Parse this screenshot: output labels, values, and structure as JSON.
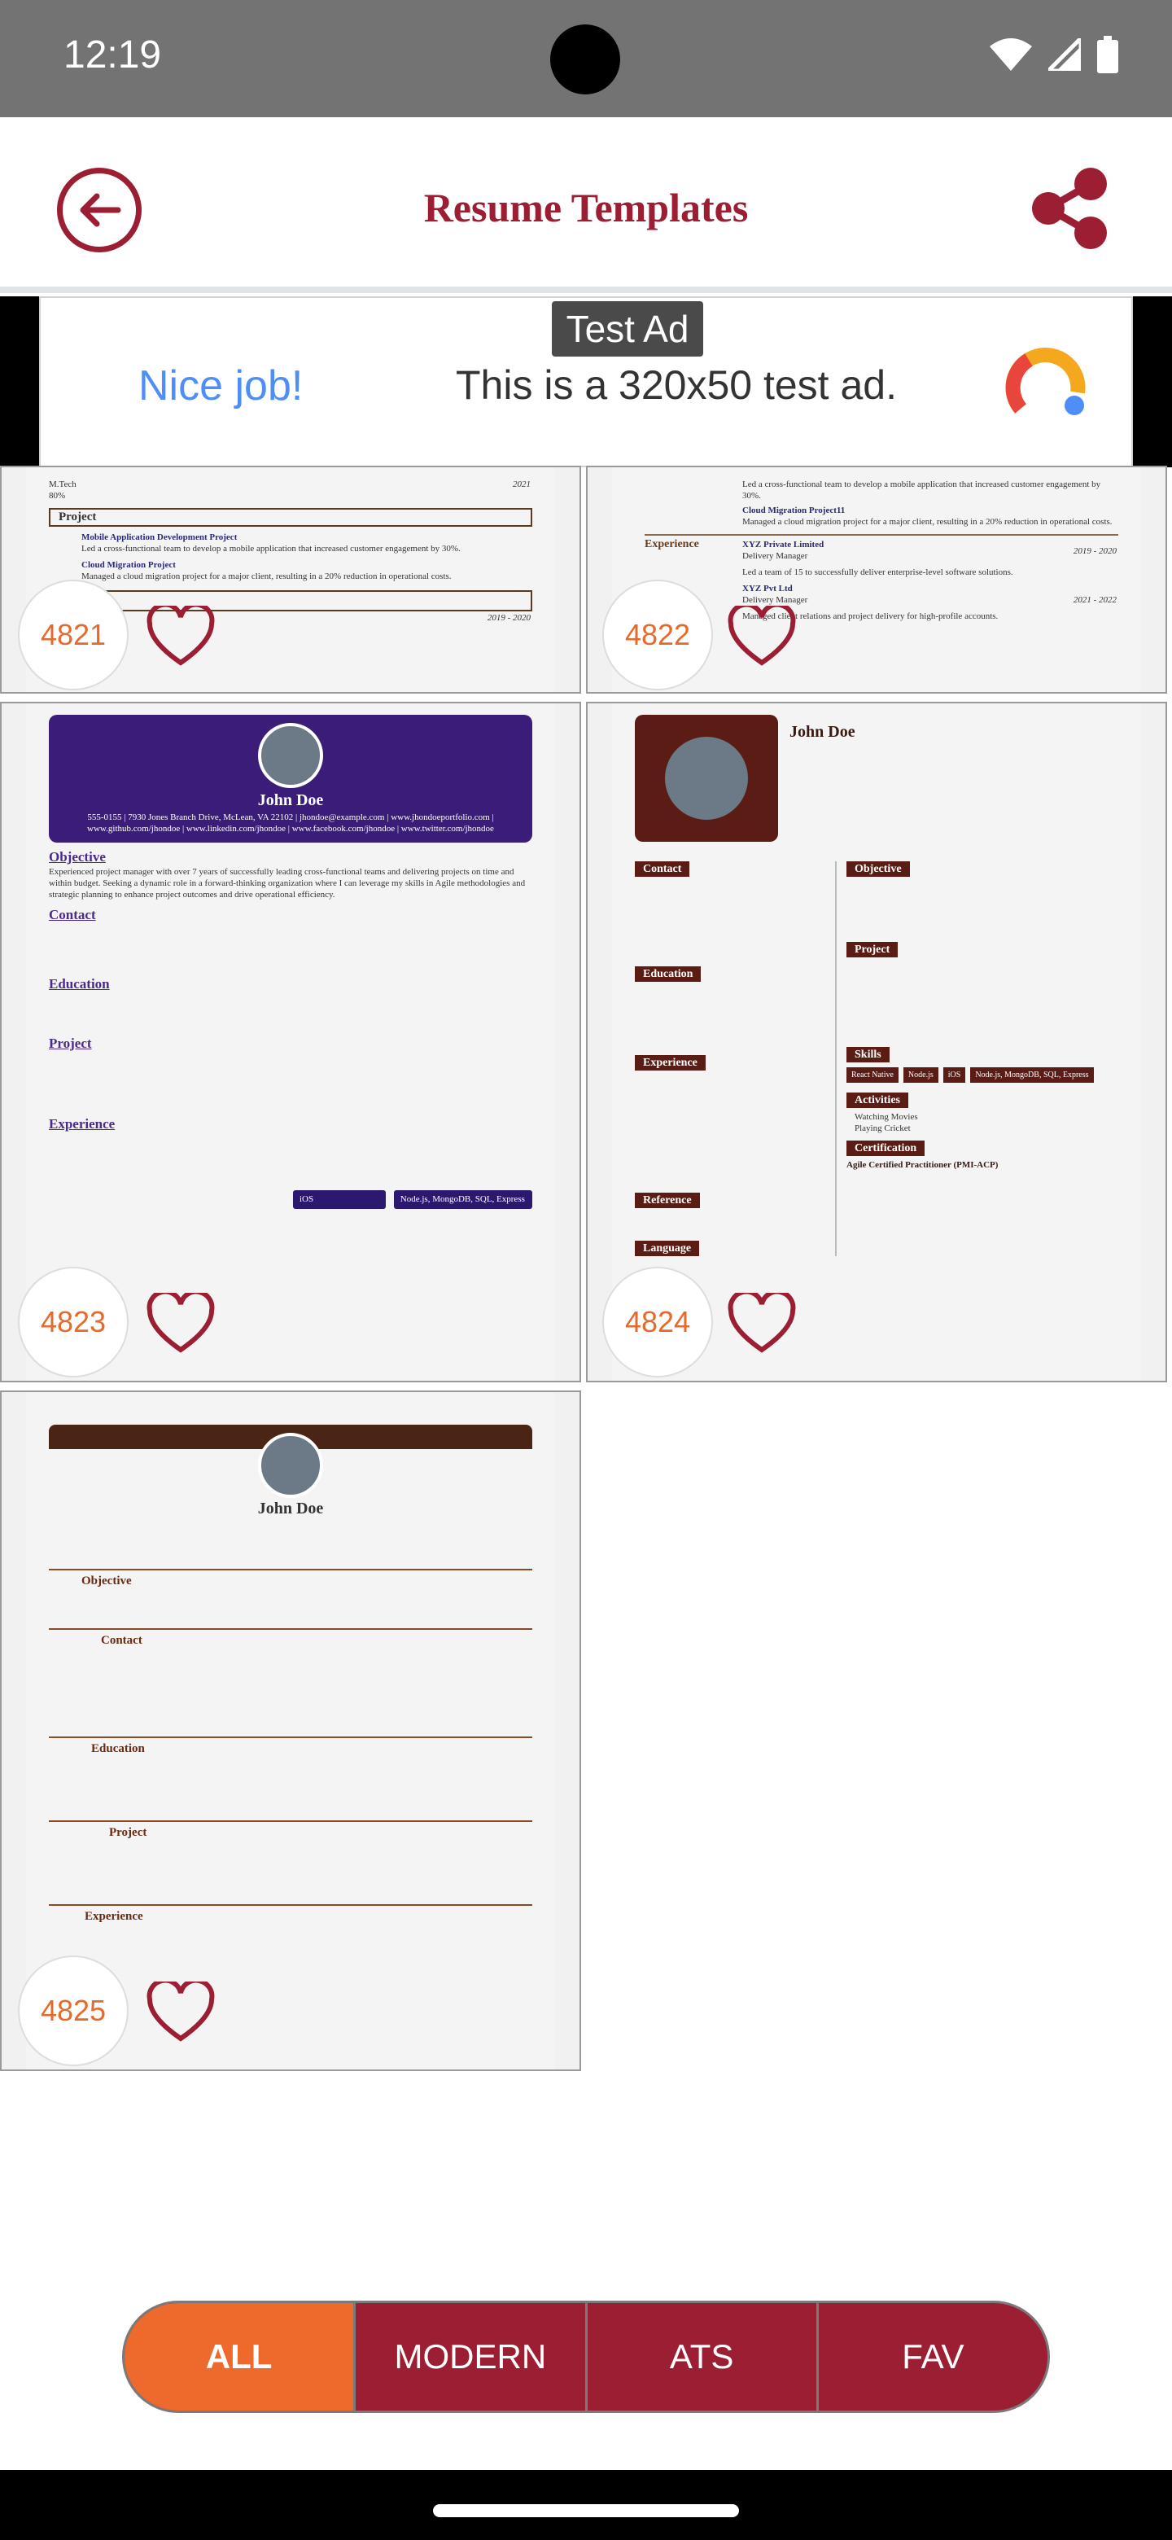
{
  "status": {
    "time": "12:19"
  },
  "header": {
    "title": "Resume Templates"
  },
  "ad": {
    "label": "Test Ad",
    "headline": "Nice job!",
    "text": "This is a 320x50 test ad."
  },
  "cards": [
    {
      "id": "4821",
      "snippet_top": "M.Tech\n80%",
      "section1": "Project",
      "item1": "Mobile Application Development Project",
      "item1_desc": "Led a cross-functional team to develop a mobile application that increased customer engagement by 30%.",
      "item2": "Cloud Migration Project",
      "item2_desc": "Managed a cloud migration project for a major client, resulting in a 20% reduction in operational costs.",
      "year": "2021",
      "year2": "2019 - 2020"
    },
    {
      "id": "4822",
      "line1": "Led a cross-functional team to develop a mobile application that increased customer engagement by 30%.",
      "proj": "Cloud Migration Project11",
      "proj_desc": "Managed a cloud migration project for a major client, resulting in a 20% reduction in operational costs.",
      "section": "Experience",
      "company1": "XYZ Private Limited",
      "role1": "Delivery Manager",
      "dates1": "2019 - 2020",
      "desc1": "Led a team of 15 to successfully deliver enterprise-level software solutions.",
      "company2": "XYZ Pvt Ltd",
      "role2": "Delivery Manager",
      "dates2": "2021 - 2022",
      "desc2": "Managed client relations and project delivery for high-profile accounts."
    },
    {
      "id": "4823",
      "name": "John Doe",
      "contact": "555-0155 | 7930 Jones Branch Drive, McLean, VA 22102 | jhondoe@example.com | www.jhondoeportfolio.com | www.github.com/jhondoe | www.linkedin.com/jhondoe | www.facebook.com/jhondoe | www.twitter.com/jhondoe",
      "objective_h": "Objective",
      "objective": "Experienced project manager with over 7 years of successfully leading cross-functional teams and delivering projects on time and within budget. Seeking a dynamic role in a forward-thinking organization where I can leverage my skills in Agile methodologies and strategic planning to enhance project outcomes and drive operational efficiency.",
      "contact_h": "Contact",
      "education_h": "Education",
      "project_h": "Project",
      "experience_h": "Experience",
      "skills": [
        "iOS",
        "Node.js, MongoDB, SQL, Express"
      ]
    },
    {
      "id": "4824",
      "name": "John Doe",
      "contact_h": "Contact",
      "objective_h": "Objective",
      "education_h": "Education",
      "project_h": "Project",
      "experience_h": "Experience",
      "skills_h": "Skills",
      "activities_h": "Activities",
      "certification_h": "Certification",
      "reference_h": "Reference",
      "language_h": "Language",
      "skills": [
        "React Native",
        "Node.js",
        "iOS",
        "Node.js, MongoDB, SQL, Express"
      ],
      "activities": [
        "Watching Movies",
        "Playing Cricket"
      ],
      "cert": "Agile Certified Practitioner (PMI-ACP)"
    },
    {
      "id": "4825",
      "name": "John Doe",
      "objective_h": "Objective",
      "contact_h": "Contact",
      "education_h": "Education",
      "project_h": "Project",
      "experience_h": "Experience"
    }
  ],
  "tabs": [
    {
      "label": "ALL",
      "active": true
    },
    {
      "label": "MODERN"
    },
    {
      "label": "ATS"
    },
    {
      "label": "FAV"
    }
  ],
  "colors": {
    "brand": "#9c1e33",
    "accent": "#ee6a2c",
    "statusbar": "#737373"
  }
}
